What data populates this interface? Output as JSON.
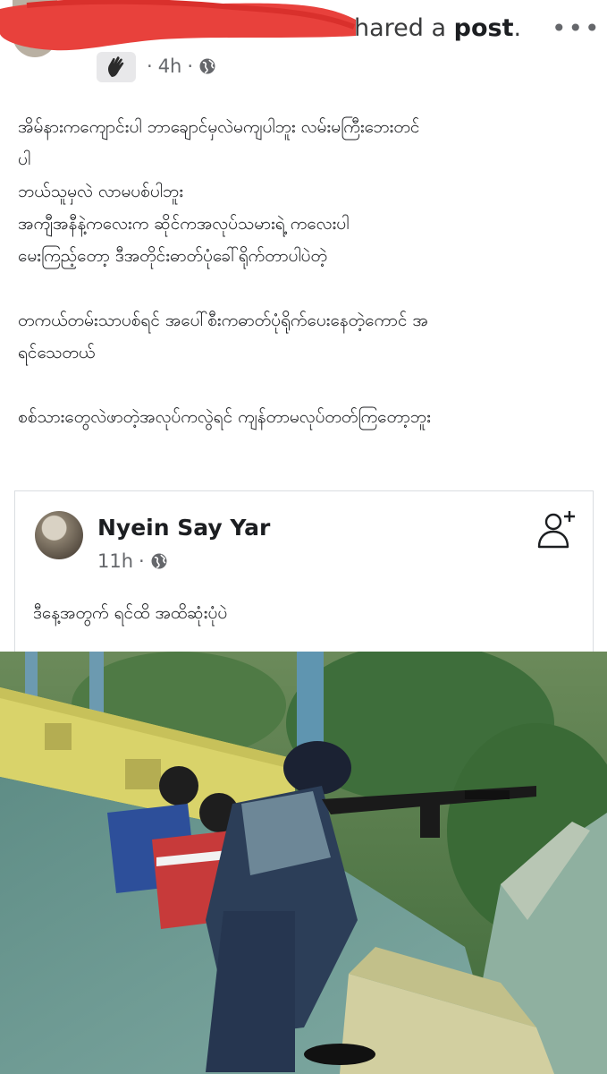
{
  "header": {
    "shared_prefix": "hared a ",
    "shared_post_word": "post",
    "shared_suffix": ".",
    "time": "4h",
    "dot": "·",
    "more_icon": "more-options-icon"
  },
  "post": {
    "lines": [
      "အိမ်နားကကျောင်းပါ ဘာချောင်မှလဲမကျပါဘူး လမ်းမကြီးဘေးတင်",
      "ပါ",
      "ဘယ်သူမှလဲ လာမပစ်ပါဘူး",
      "အကျီအနီနဲ့ကလေးက ဆိုင်ကအလုပ်သမားရဲ့ ကလေးပါ",
      "မေးကြည့်တော့ ဒီအတိုင်းဓာတ်ပုံခေါ်ရိုက်တာပါပဲတဲ့",
      "",
      "တကယ်တမ်းသာပစ်ရင် အပေါ်စီးကဓာတ်ပုံရိုက်ပေးနေတဲ့ကောင် အ",
      "ရင်သေတယ်",
      "",
      "စစ်သားတွေလဲဖာတဲ့အလုပ်ကလွဲရင် ကျန်တာမလုပ်တတ်ကြတော့ဘူး"
    ]
  },
  "shared_card": {
    "name": "Nyein Say Yar",
    "time": "11h",
    "dot": "·",
    "text": "ဒီနေ့အတွက် ရင်ထိ အထိဆုံးပုံပဲ"
  },
  "colors": {
    "redaction": "#e8413c",
    "meta_gray": "#65676b",
    "text": "#1c1e21",
    "card_border": "#dadde1"
  }
}
